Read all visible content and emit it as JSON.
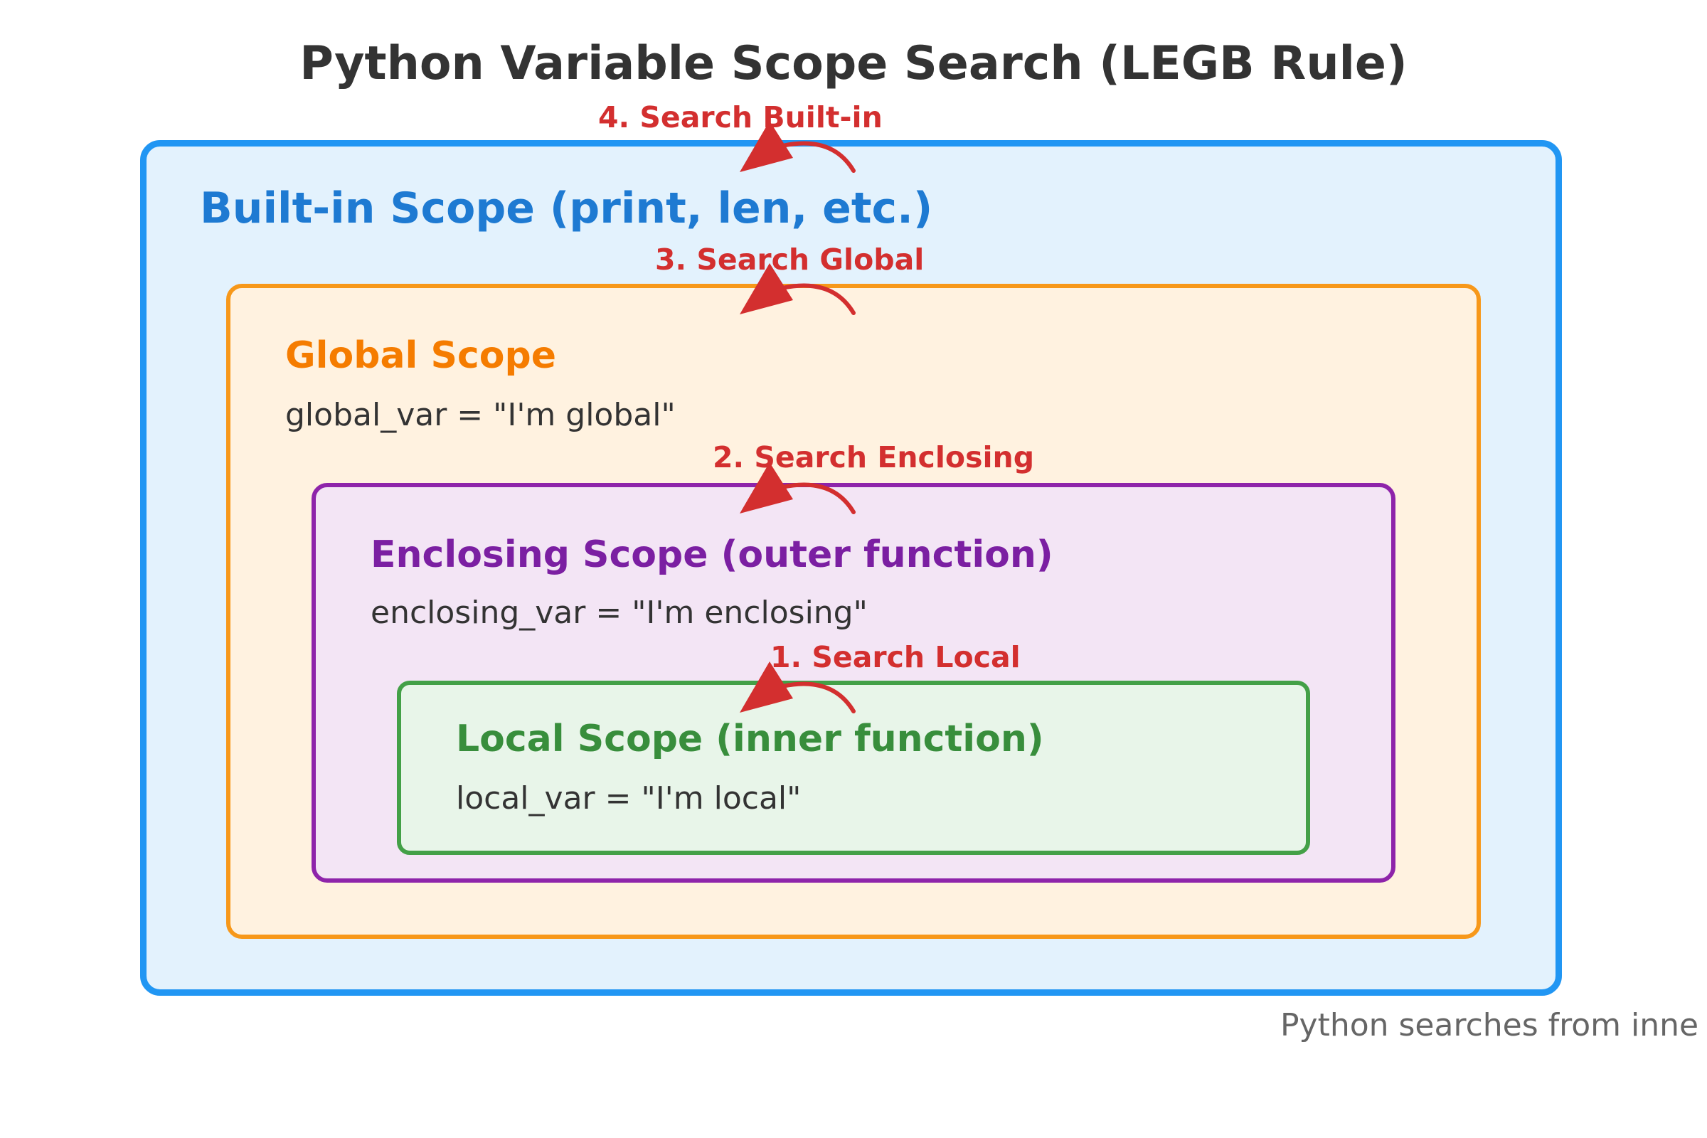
{
  "title": "Python Variable Scope Search (LEGB Rule)",
  "scopes": [
    {
      "name": "Built-in Scope (print, len, etc.)",
      "code": "",
      "color": "#1E7AD2",
      "border": "#2196F3",
      "fill": "#E3F2FD"
    },
    {
      "name": "Global Scope",
      "code": "global_var = \"I'm global\"",
      "color": "#F57C00",
      "border": "#F7981A",
      "fill": "#FFF2E0"
    },
    {
      "name": "Enclosing Scope (outer function)",
      "code": "enclosing_var = \"I'm enclosing\"",
      "color": "#7B1FA2",
      "border": "#8E24AA",
      "fill": "#F3E5F5"
    },
    {
      "name": "Local Scope (inner function)",
      "code": "local_var = \"I'm local\"",
      "color": "#388E3C",
      "border": "#43A047",
      "fill": "#E8F5E9"
    }
  ],
  "steps": [
    {
      "label": "1. Search Local"
    },
    {
      "label": "2. Search Enclosing"
    },
    {
      "label": "3. Search Global"
    },
    {
      "label": "4. Search Built-in"
    }
  ],
  "arrow_color": "#D32F2F",
  "footer": "Python searches from inne"
}
